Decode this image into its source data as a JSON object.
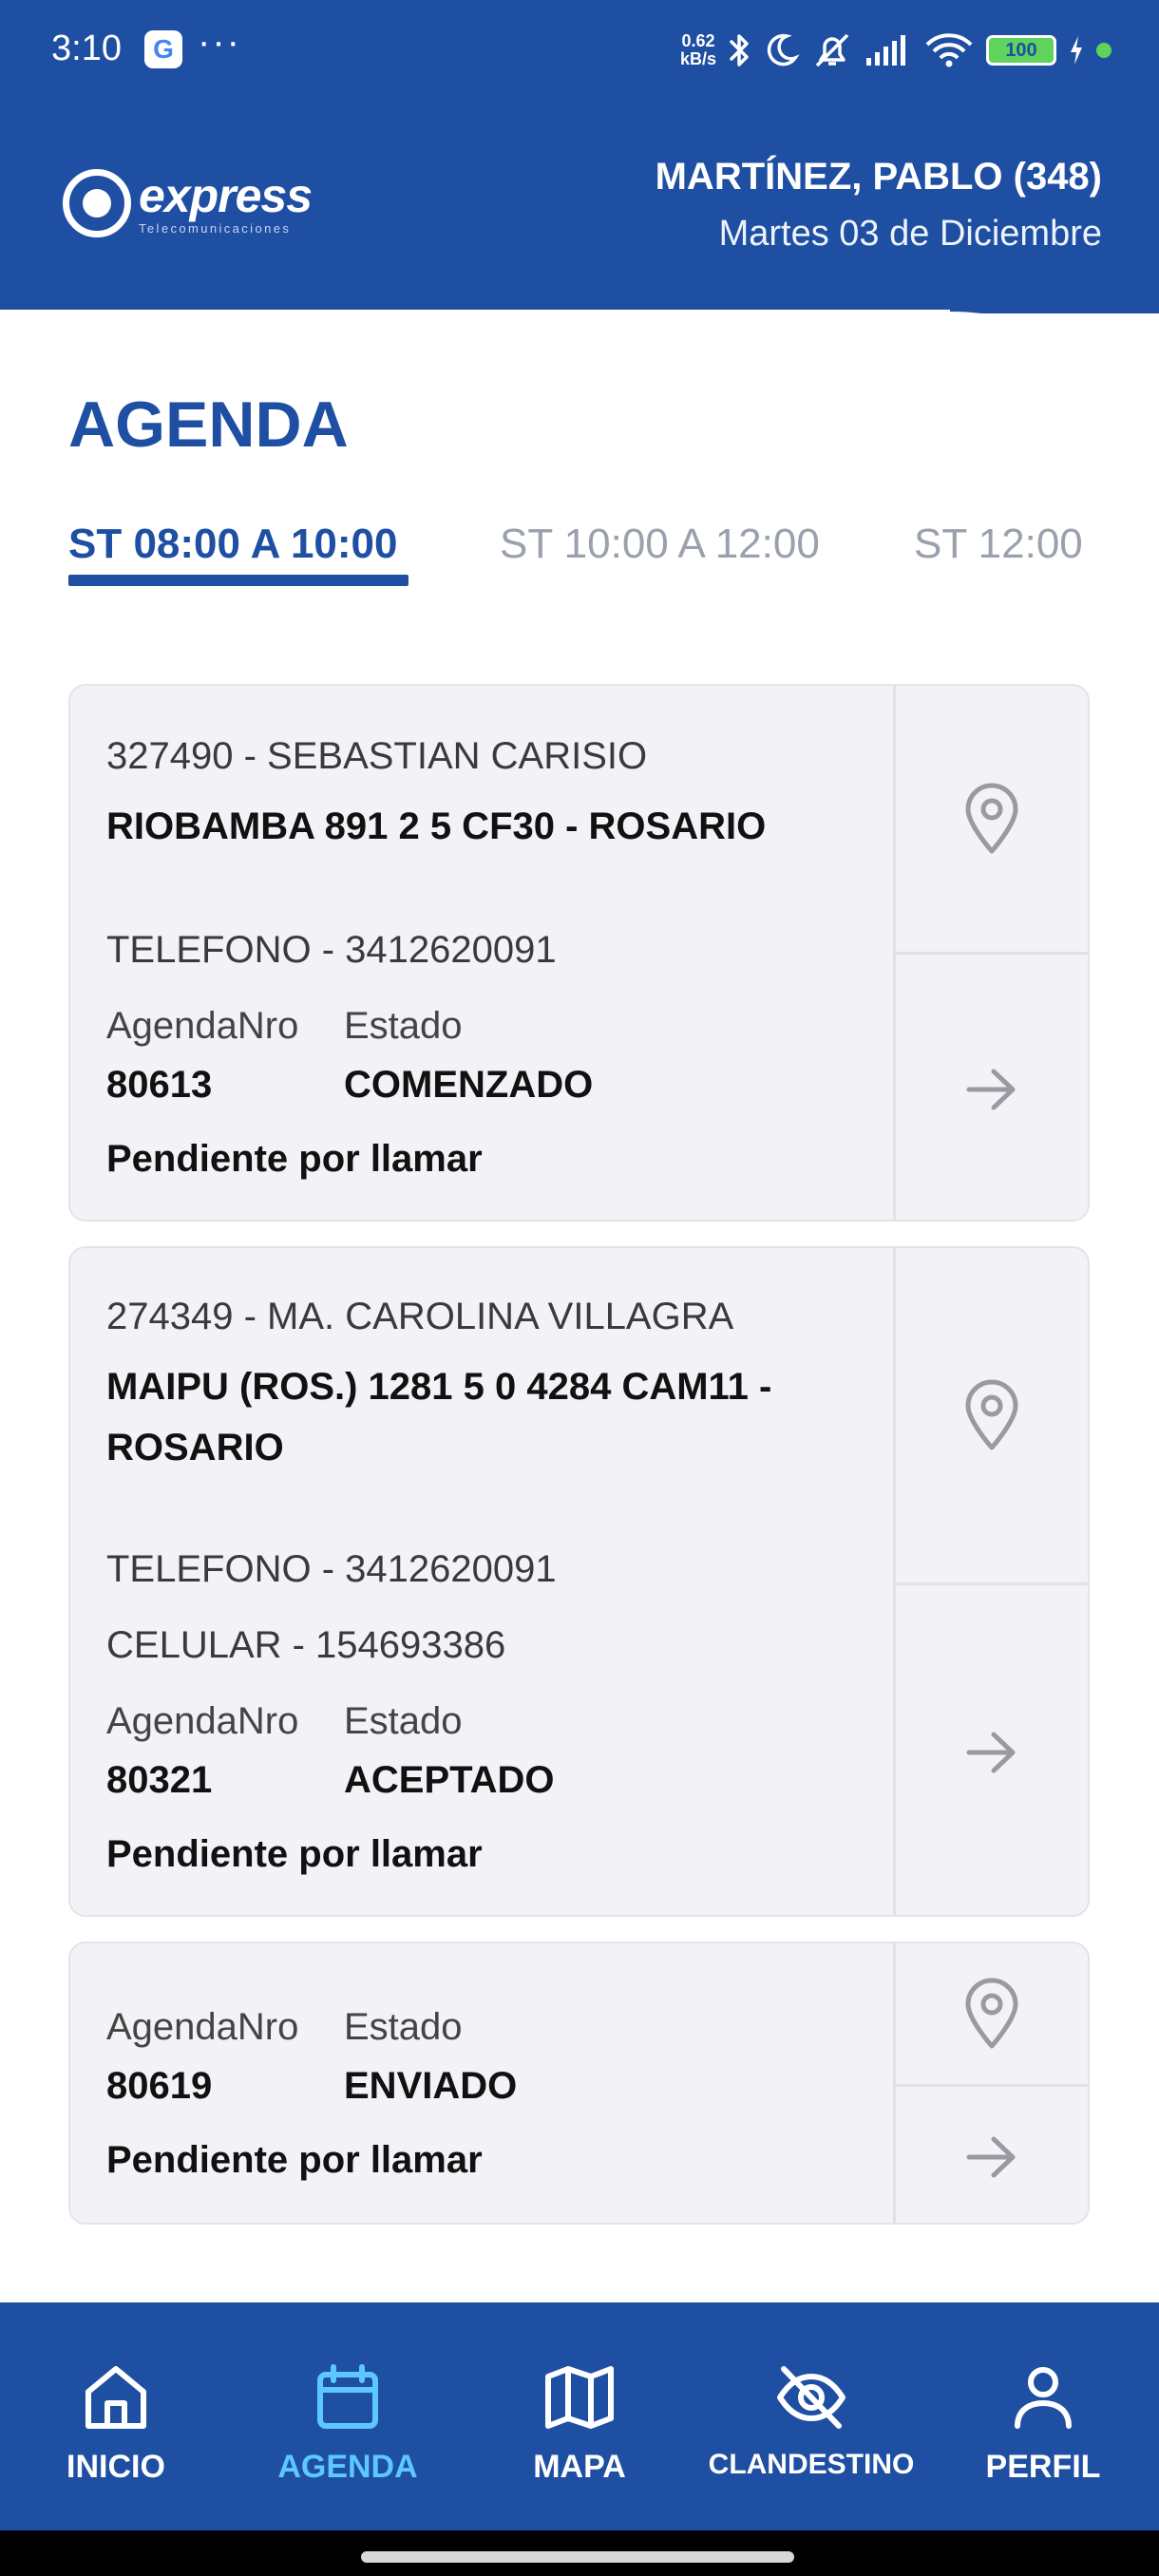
{
  "status_bar": {
    "time": "3:10",
    "g_label": "G",
    "more": "···",
    "speed_value": "0.62",
    "speed_unit": "kB/s",
    "battery": "100"
  },
  "header": {
    "logo_word": "express",
    "logo_sub": "Telecomunicaciones",
    "user_name": "MARTÍNEZ, PABLO (348)",
    "date": "Martes 03 de Diciembre"
  },
  "page": {
    "title": "AGENDA"
  },
  "tabs": [
    {
      "label": "ST 08:00 A 10:00"
    },
    {
      "label": "ST 10:00 A 12:00"
    },
    {
      "label": "ST 12:00"
    }
  ],
  "labels": {
    "agenda_nro": "AgendaNro",
    "estado": "Estado"
  },
  "cards": [
    {
      "client": "327490 - SEBASTIAN CARISIO",
      "address": "RIOBAMBA 891 2 5   CF30 - ROSARIO",
      "phone": "TELEFONO - 3412620091",
      "agenda_nro": "80613",
      "estado": "COMENZADO",
      "note": "Pendiente por llamar"
    },
    {
      "client": "274349 - MA. CAROLINA VILLAGRA",
      "address_line1": "MAIPU (ROS.) 1281 5 0  4284 CAM11 -",
      "address_line2": "ROSARIO",
      "phone": "TELEFONO - 3412620091",
      "mobile": "CELULAR - 154693386",
      "agenda_nro": "80321",
      "estado": "ACEPTADO",
      "note": "Pendiente por llamar"
    },
    {
      "agenda_nro": "80619",
      "estado": "ENVIADO",
      "note": "Pendiente por llamar"
    }
  ],
  "nav": [
    {
      "label": "INICIO",
      "icon": "home-icon"
    },
    {
      "label": "AGENDA",
      "icon": "calendar-icon"
    },
    {
      "label": "MAPA",
      "icon": "map-icon"
    },
    {
      "label": "CLANDESTINO",
      "icon": "eye-off-icon"
    },
    {
      "label": "PERFIL",
      "icon": "user-icon"
    }
  ],
  "colors": {
    "brand": "#1e4fa3",
    "active_nav": "#5cc8ff",
    "card_bg": "#f2f2f7"
  }
}
